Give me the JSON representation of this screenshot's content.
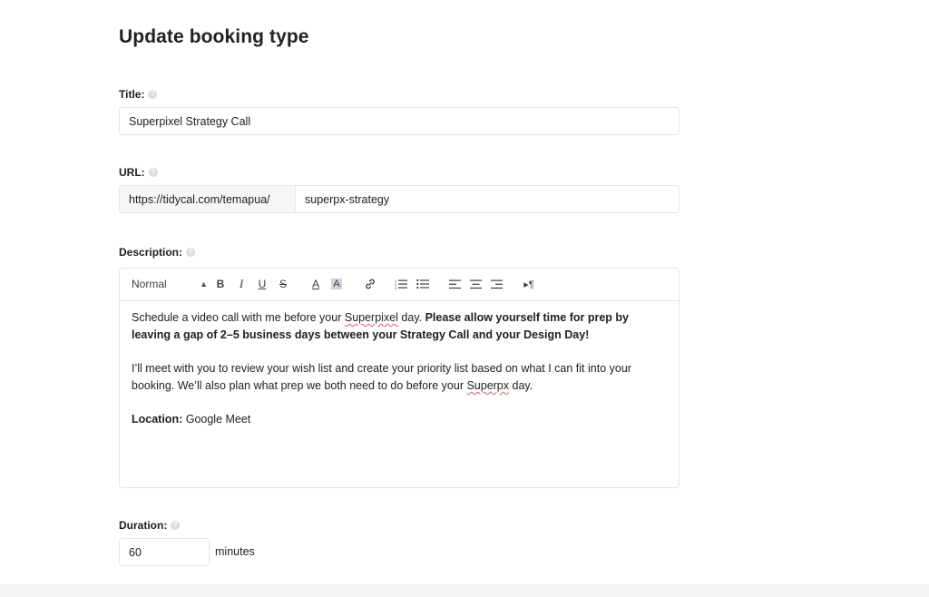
{
  "page": {
    "title": "Update booking type"
  },
  "title_field": {
    "label": "Title:",
    "value": "Superpixel Strategy Call"
  },
  "url_field": {
    "label": "URL:",
    "prefix": "https://tidycal.com/temapua/",
    "value": "superpx-strategy"
  },
  "description_field": {
    "label": "Description:",
    "toolbar": {
      "format_label": "Normal",
      "bold": "B",
      "italic": "I",
      "underline": "U",
      "strike": "S",
      "color": "A",
      "background": "A"
    },
    "content": {
      "p1_start": "Schedule a video call with me before your ",
      "p1_word": "Superpixel",
      "p1_mid": " day. ",
      "p1_bold": "Please allow yourself time for prep by leaving a gap of 2–5 business days between your Strategy Call and your Design Day!",
      "p2_start": "I’ll meet with you to review your wish list and create your priority list based on what I can fit into your booking. We’ll also plan what prep we both need to do before your ",
      "p2_word": "Superpx",
      "p2_end": " day.",
      "p3_label": "Location:",
      "p3_value": " Google Meet"
    }
  },
  "duration_field": {
    "label": "Duration:",
    "value": "60",
    "unit": "minutes"
  },
  "icons": {
    "help": "?"
  },
  "colors": {
    "border": "#e3e5e8",
    "prefix_bg": "#f5f6f8",
    "help_icon": "#d9dce1",
    "spellcheck": "#e35d6a"
  }
}
